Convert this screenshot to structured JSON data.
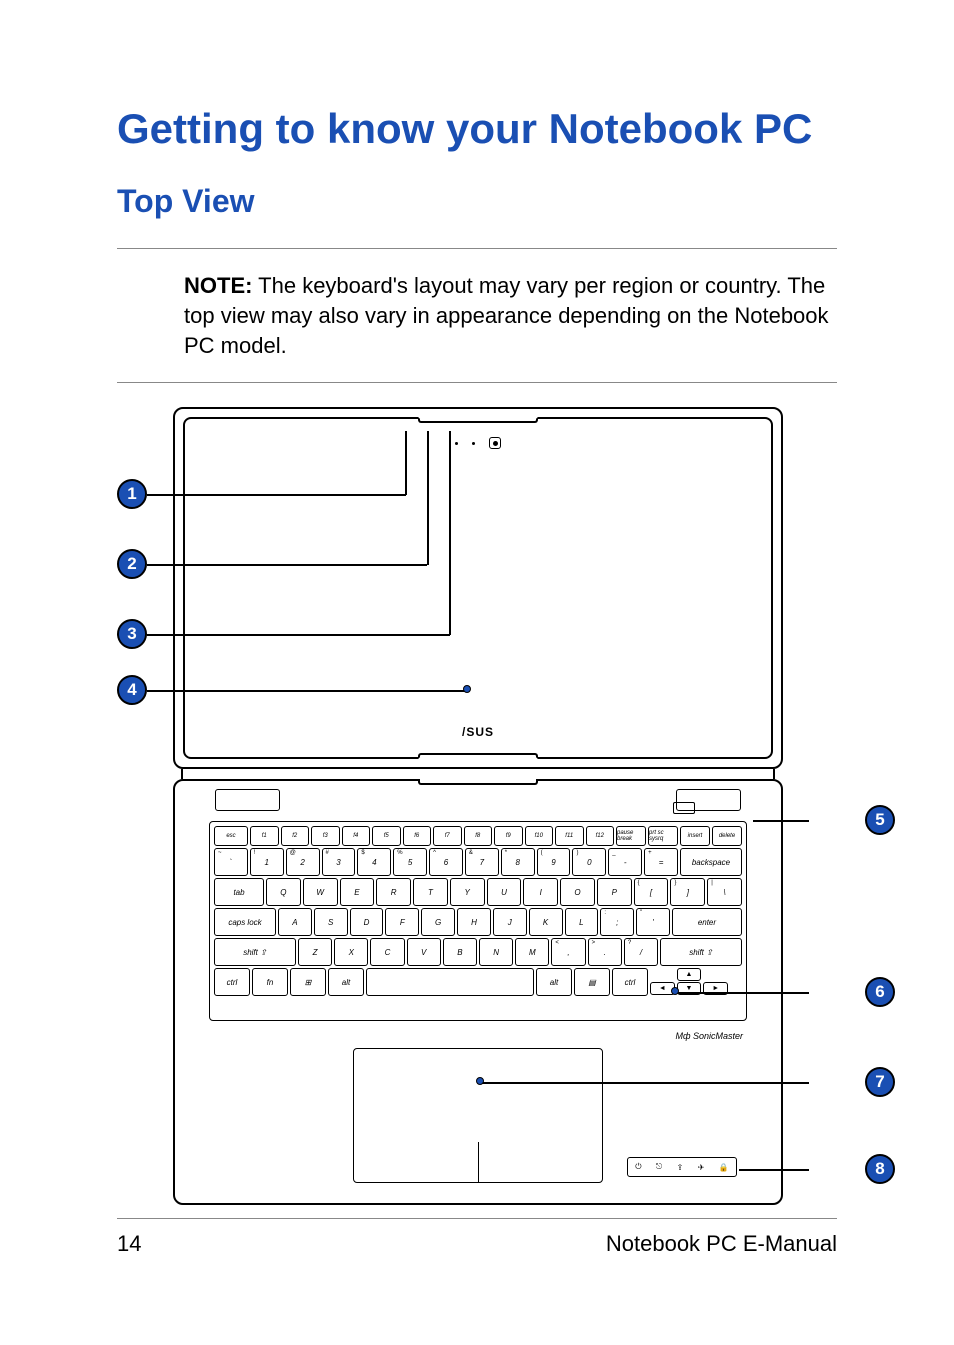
{
  "heading1": "Getting to know your Notebook PC",
  "heading2": "Top View",
  "note_label": "NOTE:",
  "note_text": " The keyboard's layout may vary per region or country. The top view may also vary in appearance depending on the Notebook PC model.",
  "brand": "/SUS",
  "sonic": "Mф SonicMaster",
  "callouts": {
    "c1": "1",
    "c2": "2",
    "c3": "3",
    "c4": "4",
    "c5": "5",
    "c6": "6",
    "c7": "7",
    "c8": "8"
  },
  "keyboard": {
    "fnrow": [
      "esc",
      "f1",
      "f2",
      "f3",
      "f4",
      "f5",
      "f6",
      "f7",
      "f8",
      "f9",
      "f10",
      "f11",
      "f12",
      "pause break",
      "prt sc sysrq",
      "insert",
      "delete"
    ],
    "row1_sup": [
      "~",
      "!",
      "@",
      "#",
      "$",
      "%",
      "^",
      "&",
      "*",
      "(",
      ")",
      "_",
      "+"
    ],
    "row1": [
      "`",
      "1",
      "2",
      "3",
      "4",
      "5",
      "6",
      "7",
      "8",
      "9",
      "0",
      "-",
      "=",
      "backspace"
    ],
    "row2": [
      "tab",
      "Q",
      "W",
      "E",
      "R",
      "T",
      "Y",
      "U",
      "I",
      "O",
      "P",
      "[",
      "]",
      "\\"
    ],
    "row2_sup": [
      "",
      "",
      "",
      "",
      "",
      "",
      "",
      "",
      "",
      "",
      "",
      "{",
      "}",
      "|"
    ],
    "row3": [
      "caps lock",
      "A",
      "S",
      "D",
      "F",
      "G",
      "H",
      "J",
      "K",
      "L",
      ";",
      "'",
      "enter"
    ],
    "row3_sup": [
      "",
      "",
      "",
      "",
      "",
      "",
      "",
      "",
      "",
      "",
      ":",
      "\"",
      ""
    ],
    "row4": [
      "shift ⇧",
      "Z",
      "X",
      "C",
      "V",
      "B",
      "N",
      "M",
      ",",
      ".",
      "/",
      "shift ⇧"
    ],
    "row4_sup": [
      "",
      "",
      "",
      "",
      "",
      "",
      "",
      "",
      "<",
      ">",
      "?",
      ""
    ],
    "row5": [
      "ctrl",
      "fn",
      "⊞",
      "alt",
      "",
      "alt",
      "▤",
      "ctrl"
    ],
    "arrows": [
      "▲",
      "◄",
      "▼",
      "►"
    ]
  },
  "status_icons": [
    "⏻",
    "⎋",
    "⇪",
    "✈",
    "🔒"
  ],
  "footer": {
    "page": "14",
    "doc": "Notebook PC E-Manual"
  }
}
